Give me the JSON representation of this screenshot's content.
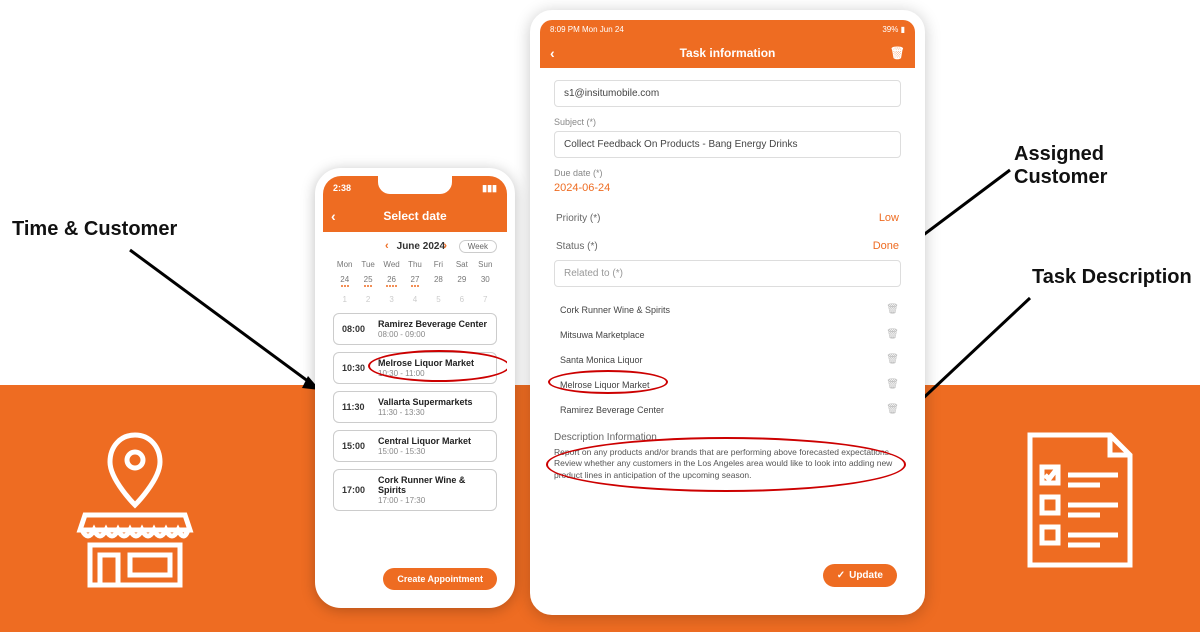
{
  "annotations": {
    "time_customer": "Time & Customer",
    "assigned_customer": "Assigned Customer",
    "task_description": "Task Description"
  },
  "phone": {
    "status_time": "2:38",
    "header_title": "Select date",
    "month_label": "June 2024",
    "week_pill": "Week",
    "day_labels": [
      "Mon",
      "Tue",
      "Wed",
      "Thu",
      "Fri",
      "Sat",
      "Sun"
    ],
    "week1": [
      "24",
      "25",
      "26",
      "27",
      "28",
      "29",
      "30"
    ],
    "week2": [
      "1",
      "2",
      "3",
      "4",
      "5",
      "6",
      "7"
    ],
    "appointments": [
      {
        "time": "08:00",
        "title": "Ramirez Beverage Center",
        "sub": "08:00 - 09:00"
      },
      {
        "time": "10:30",
        "title": "Melrose Liquor Market",
        "sub": "10:30 - 11:00"
      },
      {
        "time": "11:30",
        "title": "Vallarta Supermarkets",
        "sub": "11:30 - 13:30"
      },
      {
        "time": "15:00",
        "title": "Central Liquor Market",
        "sub": "15:00 - 15:30"
      },
      {
        "time": "17:00",
        "title": "Cork Runner Wine & Spirits",
        "sub": "17:00 - 17:30"
      }
    ],
    "create_label": "Create Appointment"
  },
  "tablet": {
    "status_left": "8:09 PM  Mon Jun 24",
    "status_right": "39%",
    "header_title": "Task information",
    "email_value": "s1@insitumobile.com",
    "subject_label": "Subject (*)",
    "subject_value": "Collect Feedback On Products - Bang Energy Drinks",
    "due_label": "Due date (*)",
    "due_value": "2024-06-24",
    "priority_label": "Priority (*)",
    "priority_value": "Low",
    "status_label": "Status (*)",
    "status_value": "Done",
    "related_label": "Related to (*)",
    "related": [
      "Cork Runner Wine & Spirits",
      "Mitsuwa Marketplace",
      "Santa Monica Liquor",
      "Melrose Liquor Market",
      "Ramirez Beverage Center"
    ],
    "desc_heading": "Description Information",
    "desc_text": "Report on any products and/or brands that are performing above forecasted expectations. Review whether any customers in the Los Angeles area would like to look into adding new product lines in anticipation of the upcoming season.",
    "update_label": "Update"
  }
}
